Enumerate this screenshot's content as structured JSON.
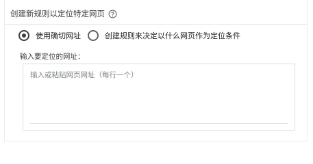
{
  "header": {
    "title": "创建新规则以定位特定网页",
    "help_icon": "help-circle-icon"
  },
  "options": [
    {
      "label": "使用确切网址",
      "selected": true
    },
    {
      "label": "创建规则来决定以什么网页作为定位条件",
      "selected": false
    }
  ],
  "url_field": {
    "label": "输入要定位的网址：",
    "placeholder": "输入或粘贴网页网址（每行一个）",
    "value": ""
  },
  "colors": {
    "text": "#3c4043",
    "border": "#dadce0",
    "placeholder": "#80868b"
  }
}
